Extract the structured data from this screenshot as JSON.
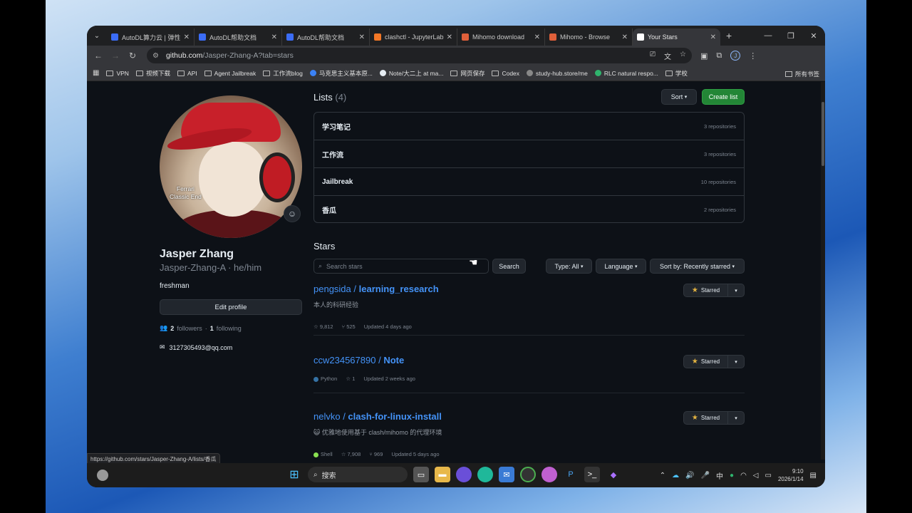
{
  "browser": {
    "tabs": [
      {
        "title": "AutoDL算力云 | 弹性",
        "color": "#3b6cf6"
      },
      {
        "title": "AutoDL帮助文档",
        "color": "#3b6cf6"
      },
      {
        "title": "AutoDL帮助文档",
        "color": "#3b6cf6"
      },
      {
        "title": "clashctl - JupyterLab",
        "color": "#f37726"
      },
      {
        "title": "Mihomo download",
        "color": "#e0603a"
      },
      {
        "title": "Mihomo - Browse",
        "color": "#e0603a"
      },
      {
        "title": "Your Stars",
        "color": "#ffffff",
        "active": true
      }
    ],
    "url_host": "github.com",
    "url_path": "/Jasper-Zhang-A?tab=stars",
    "profile_initial": "J",
    "bookmarks": [
      {
        "label": "VPN",
        "type": "folder"
      },
      {
        "label": "视频下载",
        "type": "folder"
      },
      {
        "label": "API",
        "type": "folder"
      },
      {
        "label": "Agent Jailbreak",
        "type": "folder"
      },
      {
        "label": "工作流blog",
        "type": "folder"
      },
      {
        "label": "马克思主义基本原...",
        "type": "site",
        "color": "#3b82f6"
      },
      {
        "label": "Note/大二上 at ma...",
        "type": "site",
        "color": "#e6edf3"
      },
      {
        "label": "网页保存",
        "type": "folder"
      },
      {
        "label": "Codex",
        "type": "folder"
      },
      {
        "label": "study-hub.store/me",
        "type": "site",
        "color": "#888888"
      },
      {
        "label": "RLC natural respo...",
        "type": "site",
        "color": "#2fb46d"
      },
      {
        "label": "学校",
        "type": "folder"
      }
    ],
    "all_bookmarks": "所有书签",
    "status_url": "https://github.com/stars/Jasper-Zhang-A/lists/香瓜"
  },
  "profile": {
    "avatar_caption_line1": "Ferrari",
    "avatar_caption_line2": "Classic End",
    "name": "Jasper Zhang",
    "username": "Jasper-Zhang-A · he/him",
    "bio": "freshman",
    "edit_label": "Edit profile",
    "followers_count": "2",
    "followers_label": "followers",
    "following_count": "1",
    "following_label": "following",
    "email": "3127305493@qq.com"
  },
  "lists": {
    "heading": "Lists",
    "count": "(4)",
    "sort_label": "Sort",
    "create_label": "Create list",
    "items": [
      {
        "name": "学习笔记",
        "count": "3 repositories"
      },
      {
        "name": "工作流",
        "count": "3 repositories"
      },
      {
        "name": "Jailbreak",
        "count": "10 repositories"
      },
      {
        "name": "香瓜",
        "count": "2 repositories"
      }
    ]
  },
  "stars": {
    "heading": "Stars",
    "search_placeholder": "Search stars",
    "search_label": "Search",
    "type_filter": "Type: All",
    "language_filter": "Language",
    "sort_filter": "Sort by: Recently starred",
    "starred_label": "Starred",
    "repos": [
      {
        "owner": "pengsida",
        "name": "learning_research",
        "desc": "本人的科研经验",
        "language": "",
        "lang_color": "",
        "stars": "9,812",
        "forks": "525",
        "updated": "Updated 4 days ago"
      },
      {
        "owner": "ccw234567890",
        "name": "Note",
        "desc": "",
        "language": "Python",
        "lang_color": "#3572A5",
        "stars": "1",
        "forks": "",
        "updated": "Updated 2 weeks ago"
      },
      {
        "owner": "nelvko",
        "name": "clash-for-linux-install",
        "desc": "😺 优雅地使用基于 clash/mihomo 的代理环境",
        "language": "Shell",
        "lang_color": "#89e051",
        "stars": "7,908",
        "forks": "969",
        "updated": "Updated 5 days ago"
      }
    ]
  },
  "taskbar": {
    "search_label": "搜索",
    "ime": "中",
    "time": "9:10",
    "date": "2026/1/14"
  }
}
